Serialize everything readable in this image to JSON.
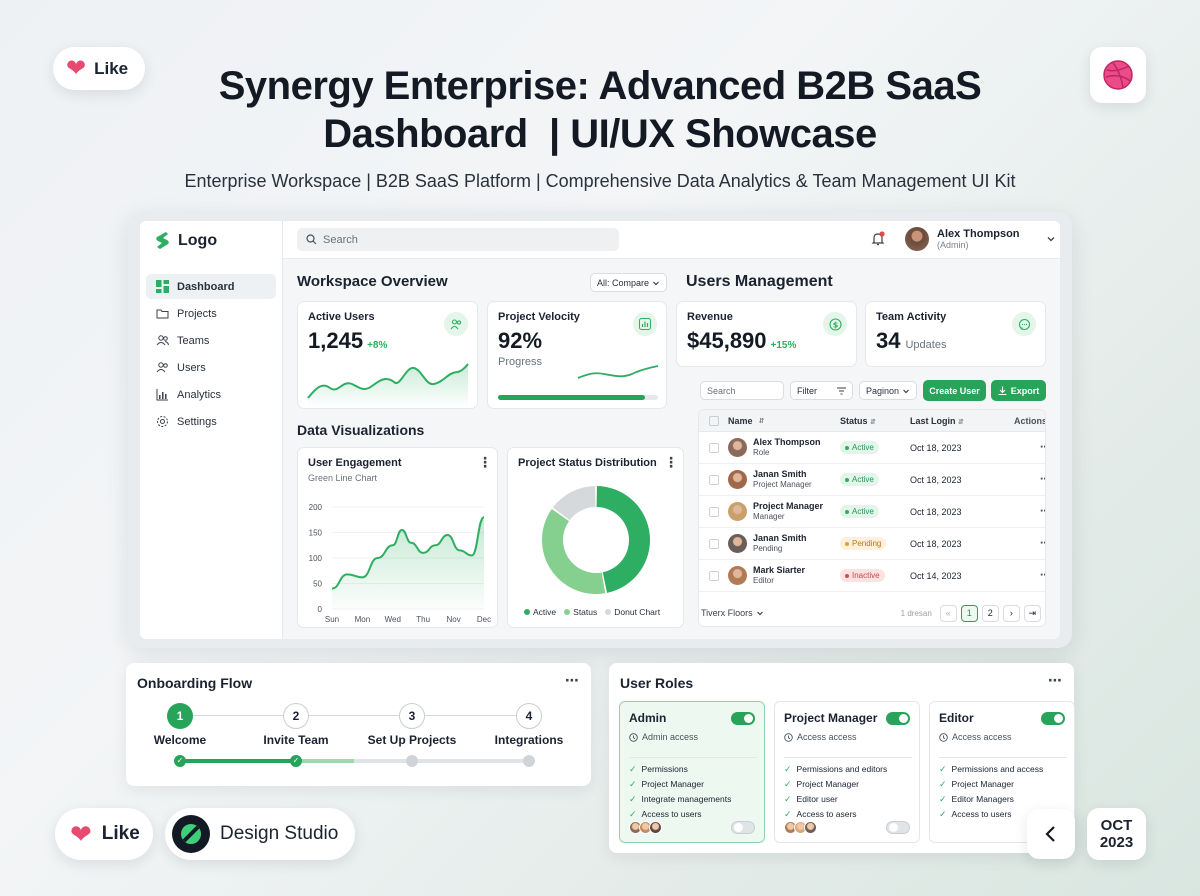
{
  "header": {
    "title_line1": "Synergy Enterprise: Advanced B2B SaaS",
    "title_line2": "Dashboard  | UI/UX Showcase",
    "subtitle": "Enterprise Workspace | B2B SaaS Platform | Comprehensive Data Analytics & Team Management UI Kit"
  },
  "like_top": "Like",
  "like_bottom": "Like",
  "studio": "Design Studio",
  "date": {
    "month": "OCT",
    "year": "2023"
  },
  "colors": {
    "accent": "#27a35a",
    "like": "#e84a6f",
    "dribbble": "#ea4c89"
  },
  "sidebar": {
    "logo": "Logo",
    "items": [
      {
        "label": "Dashboard",
        "icon": "dashboard-icon",
        "active": true
      },
      {
        "label": "Projects",
        "icon": "folder-icon"
      },
      {
        "label": "Teams",
        "icon": "team-icon"
      },
      {
        "label": "Users",
        "icon": "users-icon"
      },
      {
        "label": "Analytics",
        "icon": "analytics-icon"
      },
      {
        "label": "Settings",
        "icon": "gear-icon"
      }
    ]
  },
  "topbar": {
    "search_placeholder": "Search",
    "user_name": "Alex Thompson",
    "user_role": "(Admin)"
  },
  "workspace": {
    "title": "Workspace Overview",
    "compare": "All: Compare",
    "active_users": {
      "label": "Active Users",
      "value": "1,245",
      "delta": "+8%"
    },
    "velocity": {
      "label": "Project Velocity",
      "value": "92%",
      "caption": "Progress",
      "progress": 0.92
    }
  },
  "users_mgmt": {
    "title": "Users Management",
    "revenue": {
      "label": "Revenue",
      "value": "$45,890",
      "delta": "+15%"
    },
    "team_activity": {
      "label": "Team Activity",
      "value": "34",
      "caption": "Updates"
    },
    "toolbar": {
      "search": "Search",
      "filter": "Filter",
      "pagination": "Paginon",
      "create": "Create User",
      "export": "Export"
    },
    "columns": {
      "name": "Name",
      "status": "Status",
      "last_login": "Last Login",
      "actions": "Actions"
    },
    "rows": [
      {
        "name": "Alex Thompson",
        "sub": "Role",
        "status": "Active",
        "kind": "active",
        "login": "Oct 18, 2023",
        "action": "edit"
      },
      {
        "name": "Janan Smith",
        "sub": "Project Manager",
        "status": "Active",
        "kind": "active",
        "login": "Oct 18, 2023",
        "action": "info"
      },
      {
        "name": "Project Manager",
        "sub": "Manager",
        "status": "Active",
        "kind": "active",
        "login": "Oct 18, 2023",
        "action": "info"
      },
      {
        "name": "Janan Smith",
        "sub": "Pending",
        "status": "Pending",
        "kind": "pending",
        "login": "Oct 18, 2023",
        "action": "info"
      },
      {
        "name": "Mark Siarter",
        "sub": "Editor",
        "status": "Inactive",
        "kind": "inactive",
        "login": "Oct 14, 2023",
        "action": "info"
      }
    ],
    "footer": {
      "floors": "Tiverx Floors",
      "range": "1 dresan",
      "pages": [
        "1",
        "2"
      ]
    }
  },
  "data_viz": {
    "title": "Data Visualizations",
    "engagement": {
      "title": "User Engagement",
      "subtitle": "Green Line Chart"
    },
    "status_dist": {
      "title": "Project Status Distribution",
      "legend": [
        "Active",
        "Status",
        "Donut Chart"
      ]
    }
  },
  "chart_data": [
    {
      "type": "line",
      "title": "User Engagement",
      "subtitle": "Green Line Chart",
      "x": [
        "Sun",
        "Mon",
        "Wed",
        "Thu",
        "Nov",
        "Dec"
      ],
      "x_positions": [
        0,
        1,
        2,
        3,
        4,
        5
      ],
      "points": [
        [
          0,
          40
        ],
        [
          0.5,
          68
        ],
        [
          1.0,
          62
        ],
        [
          1.5,
          100
        ],
        [
          2.0,
          125
        ],
        [
          2.3,
          155
        ],
        [
          2.6,
          130
        ],
        [
          3.0,
          110
        ],
        [
          3.4,
          125
        ],
        [
          3.8,
          145
        ],
        [
          4.2,
          115
        ],
        [
          4.6,
          105
        ],
        [
          5.0,
          180
        ]
      ],
      "yticks": [
        0,
        50,
        100,
        150,
        200
      ],
      "ylim": [
        0,
        200
      ],
      "area": true
    },
    {
      "type": "pie",
      "title": "Project Status Distribution",
      "labels": [
        "Active",
        "Status",
        "Donut Chart"
      ],
      "values": [
        47,
        38,
        15
      ],
      "colors": [
        "#2eae63",
        "#85cf8f",
        "#d6d9dc"
      ],
      "donut": true
    }
  ],
  "onboarding": {
    "title": "Onboarding Flow",
    "steps": [
      {
        "n": "1",
        "label": "Welcome",
        "done": true
      },
      {
        "n": "2",
        "label": "Invite Team",
        "done": true
      },
      {
        "n": "3",
        "label": "Set Up Projects",
        "done": false
      },
      {
        "n": "4",
        "label": "Integrations",
        "done": false
      }
    ]
  },
  "user_roles": {
    "title": "User Roles",
    "roles": [
      {
        "name": "Admin",
        "access": "Admin access",
        "on": true,
        "selected": true,
        "toggle_bottom": false,
        "perms": [
          "Permissions",
          "Project Manager",
          "Integrate managements",
          "Access to users"
        ]
      },
      {
        "name": "Project Manager",
        "access": "Access access",
        "on": true,
        "selected": false,
        "toggle_bottom": false,
        "perms": [
          "Permissions and editors",
          "Project Manager",
          "Editor user",
          "Access to asers"
        ]
      },
      {
        "name": "Editor",
        "access": "Access access",
        "on": true,
        "selected": false,
        "toggle_bottom": false,
        "perms": [
          "Permissions and access",
          "Project Manager",
          "Editor Managers",
          "Access to users"
        ]
      }
    ]
  }
}
